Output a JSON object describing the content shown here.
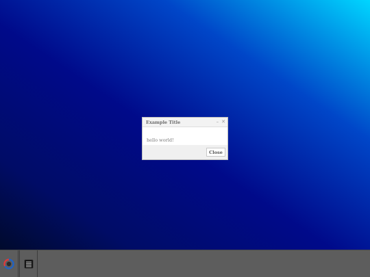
{
  "dialog": {
    "title": "Example Title",
    "minimize_glyph": "–",
    "close_glyph": "✕",
    "message": "hello world!",
    "close_button_label": "Close"
  },
  "taskbar": {
    "items": [
      {
        "icon": "app-launcher-icon"
      },
      {
        "icon": "terminal-icon"
      }
    ]
  },
  "colors": {
    "desktop_gradient": [
      "#000a2c",
      "#000a8a",
      "#00d6ff"
    ],
    "taskbar": "#5d5d5d",
    "launcher_red": "#e53935",
    "launcher_blue": "#1e63c9"
  }
}
